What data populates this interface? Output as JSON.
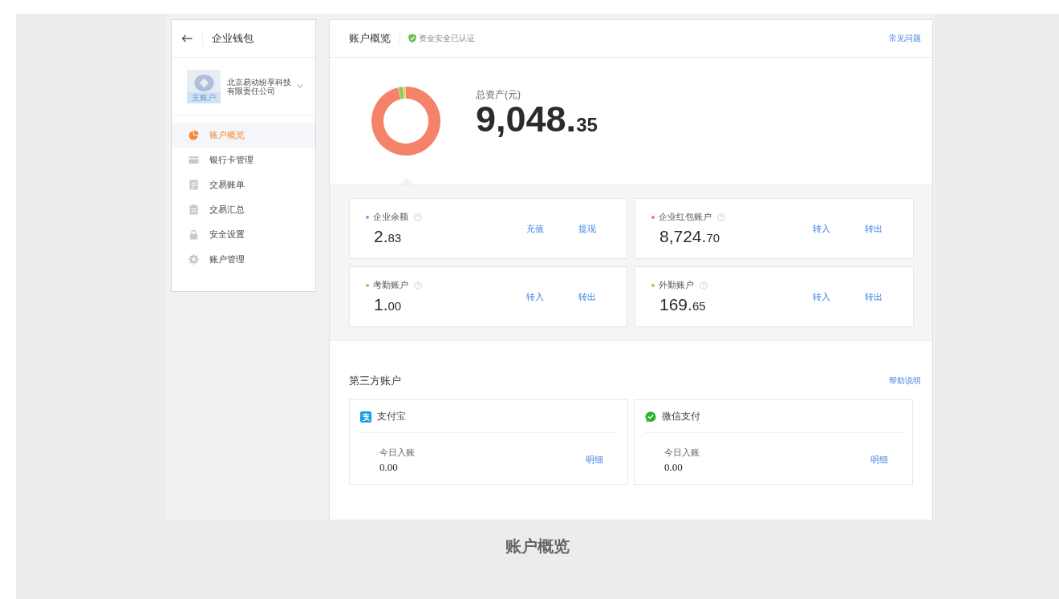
{
  "sidebar": {
    "title": "企业钱包",
    "account": {
      "badge": "主账户",
      "name": "北京易动纷享科技有限责任公司"
    },
    "menu": [
      {
        "label": "账户概览",
        "selected": true
      },
      {
        "label": "银行卡管理",
        "selected": false
      },
      {
        "label": "交易账单",
        "selected": false
      },
      {
        "label": "交易汇总",
        "selected": false
      },
      {
        "label": "安全设置",
        "selected": false
      },
      {
        "label": "账户管理",
        "selected": false
      }
    ]
  },
  "header": {
    "title": "账户概览",
    "security_note": "资金安全已认证",
    "faq_link": "常见问题"
  },
  "overview": {
    "label": "总资产(元)",
    "amount": {
      "whole": "9,048.",
      "fraction": "35"
    }
  },
  "balances": [
    {
      "label": "企业余额",
      "color": "#6ea6f0",
      "amount": {
        "whole": "2.",
        "fraction": "83"
      },
      "actions": [
        "充值",
        "提现"
      ]
    },
    {
      "label": "企业红包账户",
      "color": "#f07a62",
      "amount": {
        "whole": "8,724.",
        "fraction": "70"
      },
      "actions": [
        "转入",
        "转出"
      ]
    },
    {
      "label": "考勤账户",
      "color": "#8cd35a",
      "amount": {
        "whole": "1.",
        "fraction": "00"
      },
      "actions": [
        "转入",
        "转出"
      ]
    },
    {
      "label": "外勤账户",
      "color": "#8cd35a",
      "amount": {
        "whole": "169.",
        "fraction": "65"
      },
      "actions": [
        "转入",
        "转出"
      ]
    }
  ],
  "third_party": {
    "title": "第三方账户",
    "help_link": "帮助说明",
    "accounts": [
      {
        "kind": "alipay",
        "name": "支付宝",
        "today_label": "今日入账",
        "today_amount": "0.00",
        "detail_link": "明细"
      },
      {
        "kind": "wechat",
        "name": "微信支付",
        "today_label": "今日入账",
        "today_amount": "0.00",
        "detail_link": "明细"
      }
    ]
  },
  "caption": "账户概览"
}
